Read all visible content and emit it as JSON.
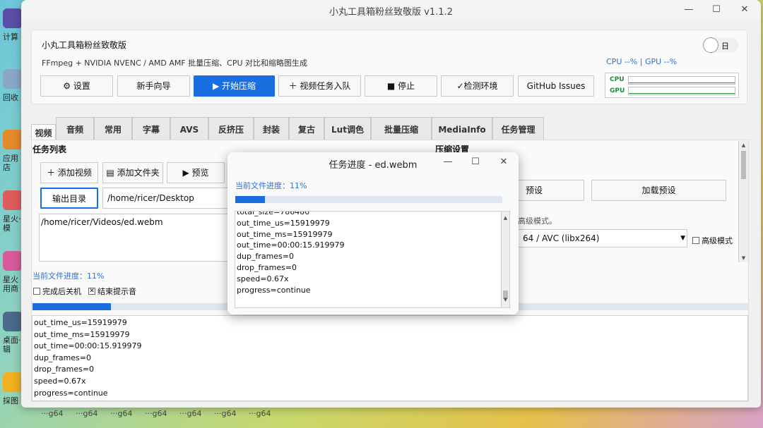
{
  "desktop": {
    "icons": [
      {
        "label": "计算"
      },
      {
        "label": "回收"
      },
      {
        "label": "应用店"
      },
      {
        "label": "星火·模"
      },
      {
        "label": "星火用商"
      },
      {
        "label": "桌面·辑"
      },
      {
        "label": "採图"
      }
    ]
  },
  "window": {
    "title": "小丸工具箱粉丝致敬版 v1.1.2",
    "minimize_icon": "—",
    "maximize_icon": "☐",
    "close_icon": "✕"
  },
  "header": {
    "app_name": "小丸工具箱粉丝致敬版",
    "subtitle": "FFmpeg + NVIDIA NVENC / AMD AMF 批量压缩、CPU 对比和缩略图生成",
    "theme_toggle_label": "日",
    "cpu_gpu_text": "CPU --%  |  GPU --%",
    "monitor": {
      "cpu_label": "CPU",
      "gpu_label": "GPU"
    }
  },
  "toolbar": {
    "settings": "⚙ 设置",
    "wizard": "新手向导",
    "start": "▶ 开始压缩",
    "enqueue": "＋ 视频任务入队",
    "stop": "■ 停止",
    "check_env": "✓检测环境",
    "github": "GitHub Issues"
  },
  "tabs": [
    "视频",
    "音频",
    "常用",
    "字幕",
    "AVS",
    "反挤压",
    "封装",
    "复古",
    "Lut调色",
    "批量压缩",
    "MediaInfo",
    "任务管理"
  ],
  "video_tab": {
    "task_list_title": "任务列表",
    "add_video": "＋ 添加视频",
    "add_folder": "▤ 添加文件夹",
    "preview": "▶ 预览",
    "output_dir_button": "输出目录",
    "output_dir_value": "/home/ricer/Desktop",
    "files": [
      "/home/ricer/Videos/ed.webm"
    ],
    "compress_settings_title": "压缩设置",
    "preset_button": "预设",
    "load_preset": "加载预设",
    "advanced_hint": "高级模式。",
    "encoder_value": "64 / AVC (libx264)",
    "advanced_mode": "高级模式",
    "current_progress": "当前文件进度：11%",
    "progress": 0.11,
    "shutdown_after": "完成后关机",
    "sound_on_finish": "结束提示音",
    "sound_checked_mark": "✕",
    "log_lines": [
      "out_time_us=15919979",
      "out_time_ms=15919979",
      "out_time=00:00:15.919979",
      "dup_frames=0",
      "drop_frames=0",
      "speed=0.67x",
      "progress=continue"
    ]
  },
  "dialog": {
    "title": "任务进度 - ed.webm",
    "current_progress": "当前文件进度：11%",
    "progress": 0.11,
    "log_lines": [
      "total_size=786480",
      "out_time_us=15919979",
      "out_time_ms=15919979",
      "out_time=00:00:15.919979",
      "dup_frames=0",
      "drop_frames=0",
      "speed=0.67x",
      "progress=continue"
    ]
  },
  "taskbar": [
    "···g64",
    "···g64",
    "···g64",
    "···g64",
    "···g64",
    "···g64",
    "···g64"
  ],
  "colors": {
    "accent": "#1a6fe0",
    "link": "#2a6fd6",
    "monitor_green": "#1e8a3a"
  }
}
